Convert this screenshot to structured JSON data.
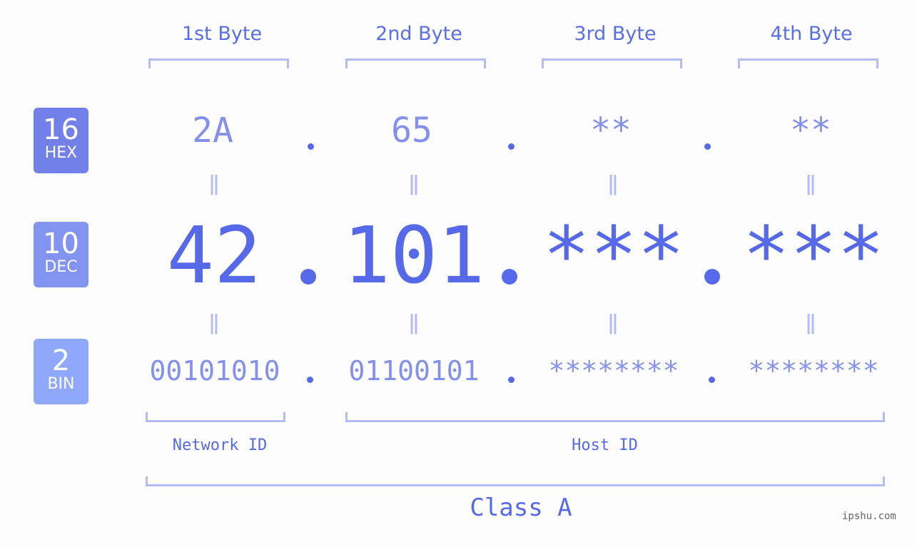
{
  "header": {
    "bytes": [
      "1st Byte",
      "2nd Byte",
      "3rd Byte",
      "4th Byte"
    ]
  },
  "badges": {
    "hex": {
      "num": "16",
      "label": "HEX",
      "color": "#7281e9"
    },
    "dec": {
      "num": "10",
      "label": "DEC",
      "color": "#8393f0"
    },
    "bin": {
      "num": "2",
      "label": "BIN",
      "color": "#8fa8fa"
    }
  },
  "ip": {
    "hex": [
      "2A",
      "65",
      "**",
      "**"
    ],
    "dec": [
      "42",
      "101",
      "***",
      "***"
    ],
    "bin": [
      "00101010",
      "01100101",
      "********",
      "********"
    ],
    "separator": ".",
    "equals": "="
  },
  "segments": {
    "network_id": "Network ID",
    "host_id": "Host ID",
    "class": "Class A"
  },
  "colors": {
    "primary": "#566ae9",
    "light": "#8491ec",
    "bracket": "#b3bcf6"
  },
  "watermark": "ipshu.com"
}
